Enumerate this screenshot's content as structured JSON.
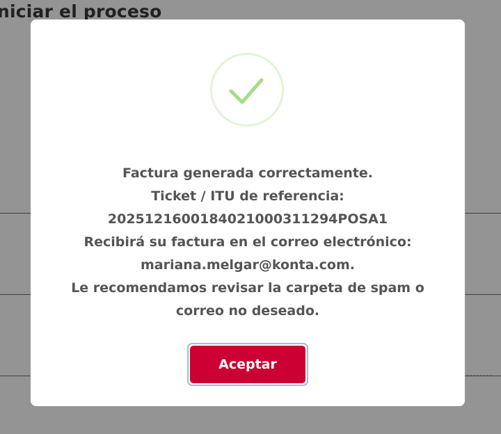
{
  "background": {
    "heading": "niciar el proceso",
    "dots": "........"
  },
  "dialog": {
    "icon": "checkmark-icon",
    "lines": [
      "Factura generada correctamente.",
      "Ticket / ITU de referencia:",
      "2025121600184021000311294POSA1",
      "Recibirá su factura en el correo electrónico:",
      "mariana.melgar@konta.com.",
      "Le recomendamos revisar la carpeta de spam o",
      "correo no deseado."
    ],
    "accept_label": "Aceptar"
  },
  "colors": {
    "accent": "#cc0033",
    "success": "#a5dc86",
    "success_ring": "#e2f3d8"
  }
}
